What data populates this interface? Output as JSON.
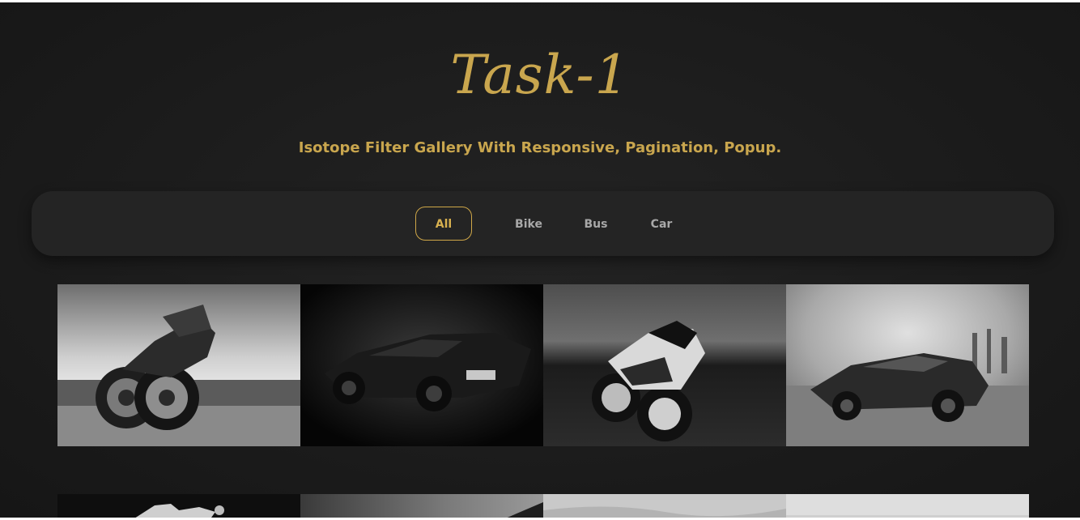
{
  "header": {
    "title": "Task-1",
    "subtitle": "Isotope Filter Gallery With Responsive, Pagination, Popup."
  },
  "filters": [
    {
      "label": "All",
      "active": true
    },
    {
      "label": "Bike",
      "active": false
    },
    {
      "label": "Bus",
      "active": false
    },
    {
      "label": "Car",
      "active": false
    }
  ],
  "gallery": {
    "items": [
      {
        "category": "bike",
        "description": "black-and-white motorcycle photo"
      },
      {
        "category": "car",
        "description": "dark sports car photo"
      },
      {
        "category": "bike",
        "description": "sport motorcycle photo"
      },
      {
        "category": "car",
        "description": "sports car in smoke photo"
      },
      {
        "category": "bike"
      },
      {
        "category": "car"
      },
      {
        "category": "car"
      },
      {
        "category": "car"
      }
    ]
  },
  "colors": {
    "background": "#1b1b1b",
    "accent": "#c9a64e",
    "filter_bar": "#242424",
    "filter_text": "#a8a8a8"
  }
}
